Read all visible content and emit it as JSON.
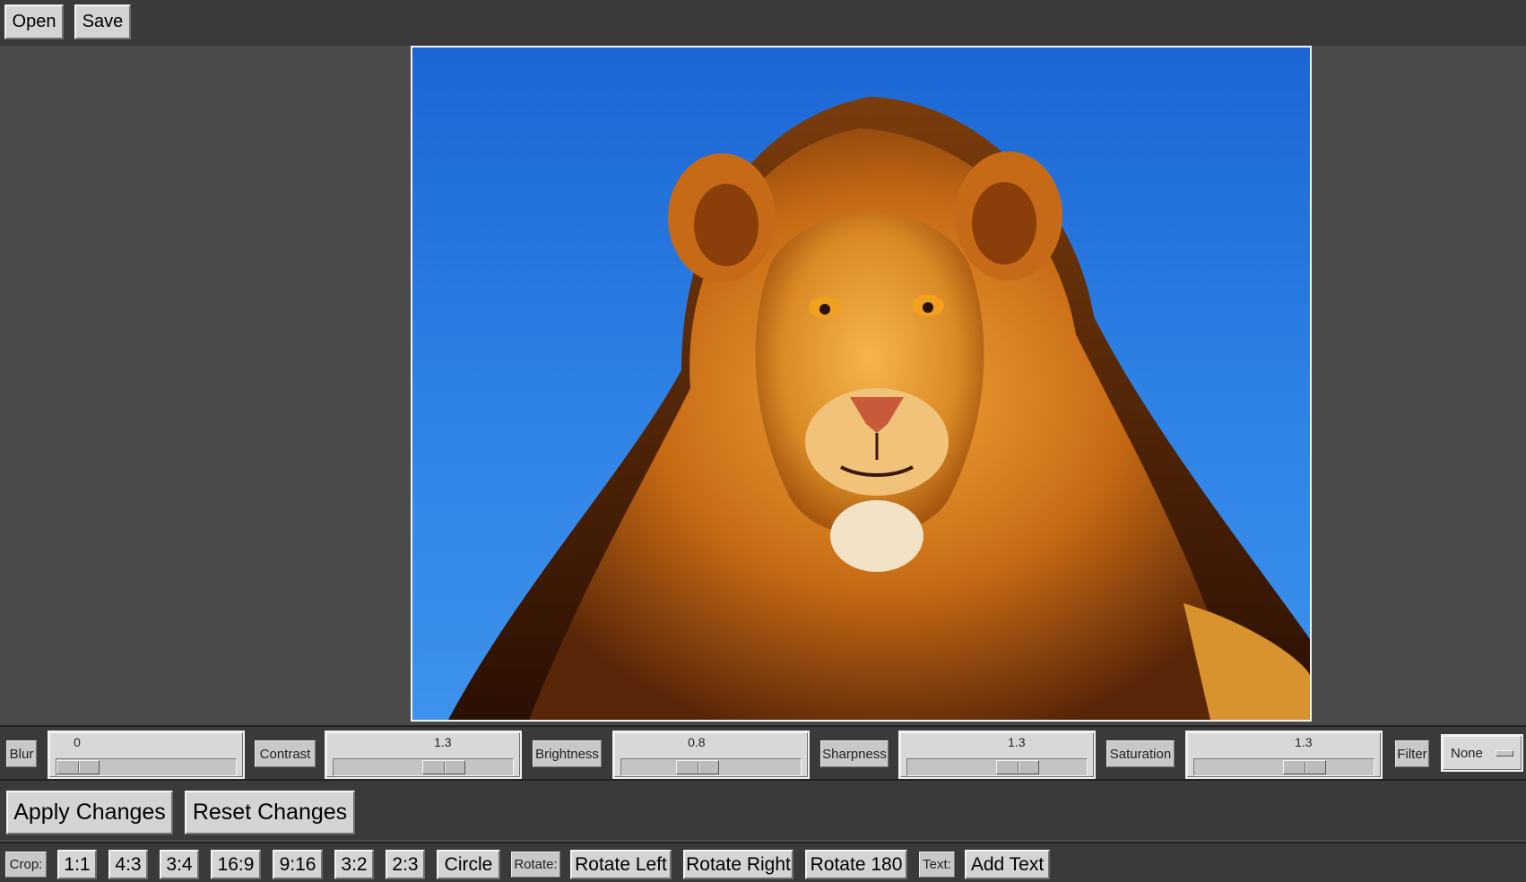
{
  "toolbar": {
    "open_label": "Open",
    "save_label": "Save"
  },
  "image": {
    "subject_icon": "lion-photo"
  },
  "adjustments": {
    "blur": {
      "label": "Blur",
      "value": "0",
      "level": 0.0
    },
    "contrast": {
      "label": "Contrast",
      "value": "1.3",
      "level": 0.65
    },
    "brightness": {
      "label": "Brightness",
      "value": "0.8",
      "level": 0.4
    },
    "sharpness": {
      "label": "Sharpness",
      "value": "1.3",
      "level": 0.65
    },
    "saturation": {
      "label": "Saturation",
      "value": "1.3",
      "level": 0.65
    },
    "filter": {
      "label": "Filter",
      "selected": "None"
    }
  },
  "actions": {
    "apply_label": "Apply Changes",
    "reset_label": "Reset Changes"
  },
  "crop": {
    "label": "Crop:",
    "options": [
      "1:1",
      "4:3",
      "3:4",
      "16:9",
      "9:16",
      "3:2",
      "2:3",
      "Circle"
    ]
  },
  "rotate": {
    "label": "Rotate:",
    "left": "Rotate Left",
    "right": "Rotate Right",
    "r180": "Rotate 180"
  },
  "text": {
    "label": "Text:",
    "add": "Add Text"
  }
}
